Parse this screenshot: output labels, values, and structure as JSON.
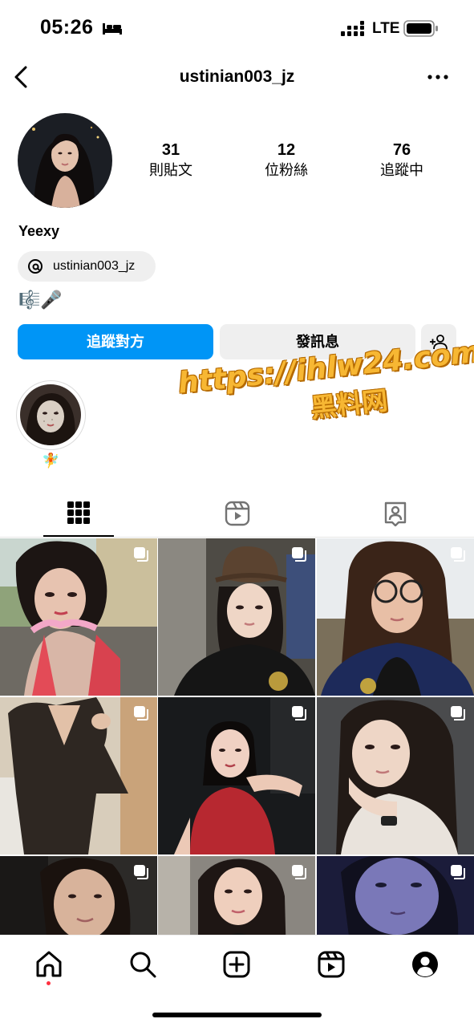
{
  "status_bar": {
    "time": "05:26",
    "network": "LTE",
    "icons": [
      "bed-icon",
      "signal-icon",
      "battery-icon"
    ]
  },
  "header": {
    "username": "ustinian003_jz",
    "icons": [
      "back-arrow-icon",
      "more-icon"
    ]
  },
  "profile": {
    "stats": [
      {
        "value": "31",
        "label": "則貼文"
      },
      {
        "value": "12",
        "label": "位粉絲"
      },
      {
        "value": "76",
        "label": "追蹤中"
      }
    ],
    "display_name": "Yeexy",
    "threads_handle": "ustinian003_jz",
    "bio": "🎼🎤"
  },
  "actions": {
    "follow": "追蹤對方",
    "message": "發訊息",
    "suggest_icon": "add-person-icon"
  },
  "highlights": [
    {
      "label": "🧚"
    }
  ],
  "watermark": {
    "line1": "https://ihlw24.com",
    "line2": "黑料网"
  },
  "tabs": [
    {
      "icon": "grid-icon",
      "selected": true
    },
    {
      "icon": "reels-icon",
      "selected": false
    },
    {
      "icon": "tagged-icon",
      "selected": false
    }
  ],
  "bottom_nav": {
    "items": [
      "home-icon",
      "search-icon",
      "create-icon",
      "reels-icon",
      "profile-icon"
    ],
    "notification_dot": true
  },
  "colors": {
    "accent": "#0095f6",
    "button_gray": "#efefef",
    "watermark": "#f7b733",
    "notification": "#ff3040"
  }
}
